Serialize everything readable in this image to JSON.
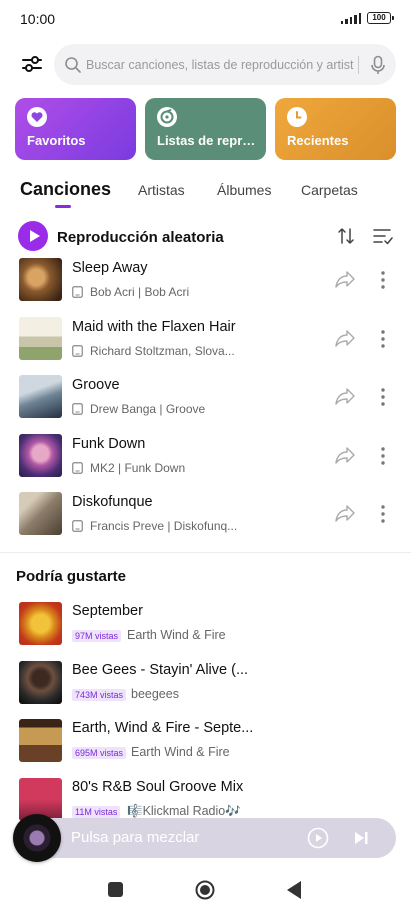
{
  "status_bar": {
    "time": "10:00",
    "battery": "100"
  },
  "search": {
    "placeholder": "Buscar canciones, listas de reproducción y artist..."
  },
  "tiles": [
    {
      "label": "Favoritos",
      "icon": "heart-icon"
    },
    {
      "label": "Listas de reprod...",
      "icon": "playlist-disc-icon"
    },
    {
      "label": "Recientes",
      "icon": "clock-icon"
    }
  ],
  "tabs": [
    "Canciones",
    "Artistas",
    "Álbumes",
    "Carpetas"
  ],
  "shuffle": {
    "label": "Reproducción aleatoria"
  },
  "songs": [
    {
      "title": "Sleep Away",
      "subtitle": "Bob Acri | Bob Acri"
    },
    {
      "title": "Maid with the Flaxen Hair",
      "subtitle": "Richard Stoltzman, Slova..."
    },
    {
      "title": "Groove",
      "subtitle": "Drew Banga | Groove"
    },
    {
      "title": "Funk Down",
      "subtitle": "MK2 | Funk Down"
    },
    {
      "title": "Diskofunque",
      "subtitle": "Francis Preve | Diskofunq..."
    }
  ],
  "recommend": {
    "title": "Podría gustarte",
    "items": [
      {
        "title": "September",
        "views": "97M vistas",
        "artist": "Earth Wind & Fire"
      },
      {
        "title": "Bee Gees - Stayin' Alive (...",
        "views": "743M vistas",
        "artist": "beegees"
      },
      {
        "title": "Earth, Wind & Fire - Septe...",
        "views": "695M vistas",
        "artist": "Earth Wind & Fire"
      },
      {
        "title": "80's R&B Soul Groove Mix",
        "views": "11M vistas",
        "artist": "🎼Klickmal Radio🎶"
      }
    ]
  },
  "mini_player": {
    "label": "Pulsa para mezclar"
  },
  "colors": {
    "accent": "#9a2be8",
    "favorites_tile": "#8f45e6",
    "playlists_tile": "#5b8e79",
    "recent_tile": "#e59c33"
  }
}
